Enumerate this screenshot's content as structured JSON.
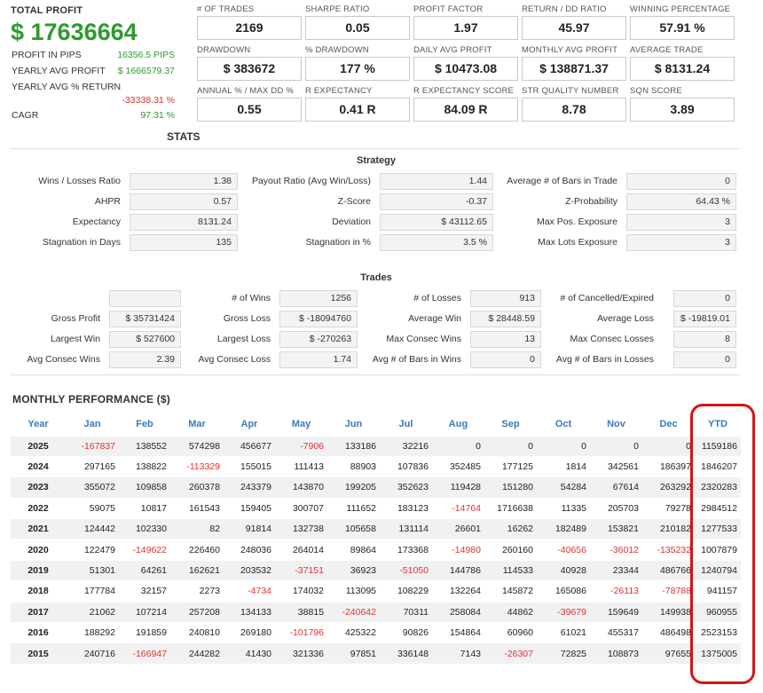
{
  "summary": {
    "total_profit_label": "TOTAL PROFIT",
    "total_profit_value": "$ 17636664",
    "rows": [
      {
        "label": "PROFIT IN PIPS",
        "value": "16356.5 PIPS"
      },
      {
        "label": "YEARLY AVG PROFIT",
        "value": "$ 1666579.37"
      },
      {
        "label": "YEARLY AVG % RETURN",
        "value": "-33338.31 %"
      },
      {
        "label": "CAGR",
        "value": "97.31 %"
      }
    ]
  },
  "metrics": [
    {
      "label": "# OF TRADES",
      "value": "2169"
    },
    {
      "label": "SHARPE RATIO",
      "value": "0.05"
    },
    {
      "label": "PROFIT FACTOR",
      "value": "1.97"
    },
    {
      "label": "RETURN / DD RATIO",
      "value": "45.97"
    },
    {
      "label": "WINNING PERCENTAGE",
      "value": "57.91 %"
    },
    {
      "label": "DRAWDOWN",
      "value": "$ 383672"
    },
    {
      "label": "% DRAWDOWN",
      "value": "177 %"
    },
    {
      "label": "DAILY AVG PROFIT",
      "value": "$ 10473.08"
    },
    {
      "label": "MONTHLY AVG PROFIT",
      "value": "$ 138871.37"
    },
    {
      "label": "AVERAGE TRADE",
      "value": "$ 8131.24"
    },
    {
      "label": "ANNUAL % / MAX DD %",
      "value": "0.55"
    },
    {
      "label": "R EXPECTANCY",
      "value": "0.41 R"
    },
    {
      "label": "R EXPECTANCY SCORE",
      "value": "84.09 R"
    },
    {
      "label": "STR QUALITY NUMBER",
      "value": "8.78"
    },
    {
      "label": "SQN SCORE",
      "value": "3.89"
    }
  ],
  "stats_title": "STATS",
  "strategy": {
    "title": "Strategy",
    "rows": [
      [
        {
          "label": "Wins / Losses Ratio",
          "value": "1.38"
        },
        {
          "label": "Payout Ratio (Avg Win/Loss)",
          "value": "1.44"
        },
        {
          "label": "Average # of Bars in Trade",
          "value": "0"
        }
      ],
      [
        {
          "label": "AHPR",
          "value": "0.57"
        },
        {
          "label": "Z-Score",
          "value": "-0.37"
        },
        {
          "label": "Z-Probability",
          "value": "64.43 %"
        }
      ],
      [
        {
          "label": "Expectancy",
          "value": "8131.24"
        },
        {
          "label": "Deviation",
          "value": "$ 43112.65"
        },
        {
          "label": "Max Pos. Exposure",
          "value": "3"
        }
      ],
      [
        {
          "label": "Stagnation in Days",
          "value": "135"
        },
        {
          "label": "Stagnation in %",
          "value": "3.5 %"
        },
        {
          "label": "Max Lots Exposure",
          "value": "3"
        }
      ]
    ]
  },
  "trades": {
    "title": "Trades",
    "rows": [
      [
        {
          "label": "",
          "value": ""
        },
        {
          "label": "# of Wins",
          "value": "1256"
        },
        {
          "label": "# of Losses",
          "value": "913"
        },
        {
          "label": "# of Cancelled/Expired",
          "value": "0"
        }
      ],
      [
        {
          "label": "Gross Profit",
          "value": "$ 35731424"
        },
        {
          "label": "Gross Loss",
          "value": "$ -18094760"
        },
        {
          "label": "Average Win",
          "value": "$ 28448.59"
        },
        {
          "label": "Average Loss",
          "value": "$ -19819.01"
        }
      ],
      [
        {
          "label": "Largest Win",
          "value": "$ 527600"
        },
        {
          "label": "Largest Loss",
          "value": "$ -270263"
        },
        {
          "label": "Max Consec Wins",
          "value": "13"
        },
        {
          "label": "Max Consec Losses",
          "value": "8"
        }
      ],
      [
        {
          "label": "Avg Consec Wins",
          "value": "2.39"
        },
        {
          "label": "Avg Consec Loss",
          "value": "1.74"
        },
        {
          "label": "Avg # of Bars in Wins",
          "value": "0"
        },
        {
          "label": "Avg # of Bars in Losses",
          "value": "0"
        }
      ]
    ]
  },
  "monthly": {
    "title": "MONTHLY PERFORMANCE ($)",
    "columns": [
      "Year",
      "Jan",
      "Feb",
      "Mar",
      "Apr",
      "May",
      "Jun",
      "Jul",
      "Aug",
      "Sep",
      "Oct",
      "Nov",
      "Dec",
      "YTD"
    ],
    "rows": [
      [
        "2025",
        "-167837",
        "138552",
        "574298",
        "456677",
        "-7906",
        "133186",
        "32216",
        "0",
        "0",
        "0",
        "0",
        "0",
        "1159186"
      ],
      [
        "2024",
        "297165",
        "138822",
        "-113329",
        "155015",
        "111413",
        "88903",
        "107836",
        "352485",
        "177125",
        "1814",
        "342561",
        "186397",
        "1846207"
      ],
      [
        "2023",
        "355072",
        "109858",
        "260378",
        "243379",
        "143870",
        "199205",
        "352623",
        "119428",
        "151280",
        "54284",
        "67614",
        "263292",
        "2320283"
      ],
      [
        "2022",
        "59075",
        "10817",
        "161543",
        "159405",
        "300707",
        "111652",
        "183123",
        "-14764",
        "1716638",
        "11335",
        "205703",
        "79278",
        "2984512"
      ],
      [
        "2021",
        "124442",
        "102330",
        "82",
        "91814",
        "132738",
        "105658",
        "131114",
        "26601",
        "16262",
        "182489",
        "153821",
        "210182",
        "1277533"
      ],
      [
        "2020",
        "122479",
        "-149622",
        "226460",
        "248036",
        "264014",
        "89864",
        "173368",
        "-14980",
        "260160",
        "-40656",
        "-36012",
        "-135232",
        "1007879"
      ],
      [
        "2019",
        "51301",
        "64261",
        "162621",
        "203532",
        "-37151",
        "36923",
        "-51050",
        "144786",
        "114533",
        "40928",
        "23344",
        "486766",
        "1240794"
      ],
      [
        "2018",
        "177784",
        "32157",
        "2273",
        "-4734",
        "174032",
        "113095",
        "108229",
        "132264",
        "145872",
        "165086",
        "-26113",
        "-78788",
        "941157"
      ],
      [
        "2017",
        "21062",
        "107214",
        "257208",
        "134133",
        "38815",
        "-240642",
        "70311",
        "258084",
        "44862",
        "-39679",
        "159649",
        "149938",
        "960955"
      ],
      [
        "2016",
        "188292",
        "191859",
        "240810",
        "269180",
        "-101796",
        "425322",
        "90826",
        "154864",
        "60960",
        "61021",
        "455317",
        "486498",
        "2523153"
      ],
      [
        "2015",
        "240716",
        "-166947",
        "244282",
        "41430",
        "321336",
        "97851",
        "336148",
        "7143",
        "-26307",
        "72825",
        "108873",
        "97655",
        "1375005"
      ]
    ]
  },
  "colors": {
    "positive": "#2e9a2e",
    "negative": "#e03030",
    "header_blue": "#3b7ab8",
    "highlight": "#d41414"
  }
}
